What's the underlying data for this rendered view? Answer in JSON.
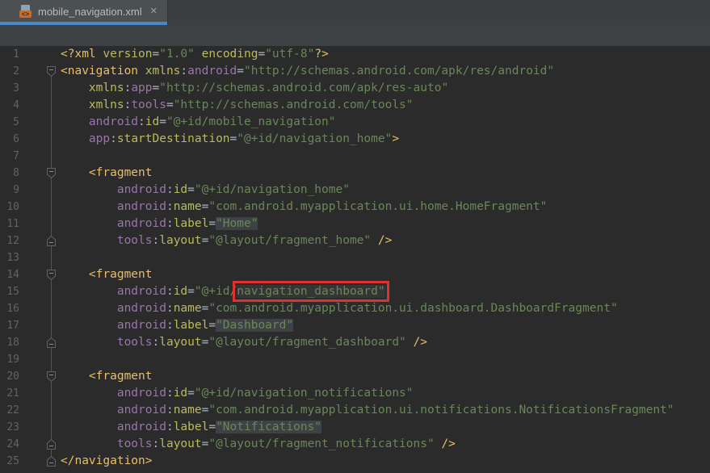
{
  "tab_bar": {
    "tabs": [
      {
        "label": "mobile_navigation.xml",
        "icon": "xml-file",
        "icon_glyph": "<>",
        "close_glyph": "✕",
        "active": true
      }
    ]
  },
  "toolbar": {},
  "colors": {
    "editor_bg": "#2B2B2B",
    "tabbar_bg": "#3C3F41",
    "active_tab_bg": "#4B5052",
    "active_tab_underline": "#4A88C7",
    "toolbar_bg": "#3E4143",
    "line_number": "#606366",
    "xml_tag": "#E8BF6A",
    "xml_attribute": "#BABB5E",
    "xml_namespace": "#9876AA",
    "xml_value": "#6A8759",
    "punctuation": "#A9B7C6",
    "label_value_highlight_bg": "#3E4245",
    "annotation_red_box": "#E03131"
  },
  "editor": {
    "annotation": {
      "shape": "red-rectangle",
      "line": 15,
      "highlighted_text": "navigation_dashboard\""
    },
    "lines": [
      {
        "num": 1,
        "fold": null,
        "tokens": [
          [
            "tag",
            "<?xml"
          ],
          [
            "sp",
            " "
          ],
          [
            "attr",
            "version"
          ],
          [
            "eq",
            "="
          ],
          [
            "val",
            "\"1.0\""
          ],
          [
            "sp",
            " "
          ],
          [
            "attr",
            "encoding"
          ],
          [
            "eq",
            "="
          ],
          [
            "val",
            "\"utf-8\""
          ],
          [
            "tag",
            "?>"
          ]
        ]
      },
      {
        "num": 2,
        "fold": "down",
        "tokens": [
          [
            "tag",
            "<navigation"
          ],
          [
            "sp",
            " "
          ],
          [
            "attr",
            "xmlns"
          ],
          [
            "eq",
            ":"
          ],
          [
            "ns",
            "android"
          ],
          [
            "eq",
            "="
          ],
          [
            "val",
            "\"http://schemas.android.com/apk/res/android\""
          ]
        ]
      },
      {
        "num": 3,
        "fold": null,
        "tokens": [
          [
            "sp",
            "    "
          ],
          [
            "attr",
            "xmlns"
          ],
          [
            "eq",
            ":"
          ],
          [
            "ns",
            "app"
          ],
          [
            "eq",
            "="
          ],
          [
            "val",
            "\"http://schemas.android.com/apk/res-auto\""
          ]
        ]
      },
      {
        "num": 4,
        "fold": null,
        "tokens": [
          [
            "sp",
            "    "
          ],
          [
            "attr",
            "xmlns"
          ],
          [
            "eq",
            ":"
          ],
          [
            "ns",
            "tools"
          ],
          [
            "eq",
            "="
          ],
          [
            "val",
            "\"http://schemas.android.com/tools\""
          ]
        ]
      },
      {
        "num": 5,
        "fold": null,
        "tokens": [
          [
            "sp",
            "    "
          ],
          [
            "ns",
            "android"
          ],
          [
            "eq",
            ":"
          ],
          [
            "attr",
            "id"
          ],
          [
            "eq",
            "="
          ],
          [
            "val",
            "\"@+id/mobile_navigation\""
          ]
        ]
      },
      {
        "num": 6,
        "fold": null,
        "tokens": [
          [
            "sp",
            "    "
          ],
          [
            "ns",
            "app"
          ],
          [
            "eq",
            ":"
          ],
          [
            "attr",
            "startDestination"
          ],
          [
            "eq",
            "="
          ],
          [
            "val",
            "\"@+id/navigation_home\""
          ],
          [
            "tag",
            ">"
          ]
        ]
      },
      {
        "num": 7,
        "fold": null,
        "tokens": []
      },
      {
        "num": 8,
        "fold": "down",
        "tokens": [
          [
            "sp",
            "    "
          ],
          [
            "tag",
            "<fragment"
          ]
        ]
      },
      {
        "num": 9,
        "fold": null,
        "tokens": [
          [
            "sp",
            "        "
          ],
          [
            "ns",
            "android"
          ],
          [
            "eq",
            ":"
          ],
          [
            "attr",
            "id"
          ],
          [
            "eq",
            "="
          ],
          [
            "val",
            "\"@+id/navigation_home\""
          ]
        ]
      },
      {
        "num": 10,
        "fold": null,
        "tokens": [
          [
            "sp",
            "        "
          ],
          [
            "ns",
            "android"
          ],
          [
            "eq",
            ":"
          ],
          [
            "attr",
            "name"
          ],
          [
            "eq",
            "="
          ],
          [
            "val",
            "\"com.android.myapplication.ui.home.HomeFragment\""
          ]
        ]
      },
      {
        "num": 11,
        "fold": null,
        "tokens": [
          [
            "sp",
            "        "
          ],
          [
            "ns",
            "android"
          ],
          [
            "eq",
            ":"
          ],
          [
            "attr",
            "label"
          ],
          [
            "eq",
            "="
          ],
          [
            "valbox",
            "\"Home\""
          ]
        ]
      },
      {
        "num": 12,
        "fold": "up",
        "tokens": [
          [
            "sp",
            "        "
          ],
          [
            "ns",
            "tools"
          ],
          [
            "eq",
            ":"
          ],
          [
            "attr",
            "layout"
          ],
          [
            "eq",
            "="
          ],
          [
            "val",
            "\"@layout/fragment_home\""
          ],
          [
            "sp",
            " "
          ],
          [
            "tag",
            "/>"
          ]
        ]
      },
      {
        "num": 13,
        "fold": null,
        "tokens": []
      },
      {
        "num": 14,
        "fold": "down",
        "tokens": [
          [
            "sp",
            "    "
          ],
          [
            "tag",
            "<fragment"
          ]
        ]
      },
      {
        "num": 15,
        "fold": null,
        "tokens": [
          [
            "sp",
            "        "
          ],
          [
            "ns",
            "android"
          ],
          [
            "eq",
            ":"
          ],
          [
            "attr",
            "id"
          ],
          [
            "eq",
            "="
          ],
          [
            "val",
            "\"@+id/"
          ],
          [
            "redbox",
            "navigation_dashboard\""
          ]
        ]
      },
      {
        "num": 16,
        "fold": null,
        "tokens": [
          [
            "sp",
            "        "
          ],
          [
            "ns",
            "android"
          ],
          [
            "eq",
            ":"
          ],
          [
            "attr",
            "name"
          ],
          [
            "eq",
            "="
          ],
          [
            "val",
            "\"com.android.myapplication.ui.dashboard.DashboardFragment\""
          ]
        ]
      },
      {
        "num": 17,
        "fold": null,
        "tokens": [
          [
            "sp",
            "        "
          ],
          [
            "ns",
            "android"
          ],
          [
            "eq",
            ":"
          ],
          [
            "attr",
            "label"
          ],
          [
            "eq",
            "="
          ],
          [
            "valbox",
            "\"Dashboard\""
          ]
        ]
      },
      {
        "num": 18,
        "fold": "up",
        "tokens": [
          [
            "sp",
            "        "
          ],
          [
            "ns",
            "tools"
          ],
          [
            "eq",
            ":"
          ],
          [
            "attr",
            "layout"
          ],
          [
            "eq",
            "="
          ],
          [
            "val",
            "\"@layout/fragment_dashboard\""
          ],
          [
            "sp",
            " "
          ],
          [
            "tag",
            "/>"
          ]
        ]
      },
      {
        "num": 19,
        "fold": null,
        "tokens": []
      },
      {
        "num": 20,
        "fold": "down",
        "tokens": [
          [
            "sp",
            "    "
          ],
          [
            "tag",
            "<fragment"
          ]
        ]
      },
      {
        "num": 21,
        "fold": null,
        "tokens": [
          [
            "sp",
            "        "
          ],
          [
            "ns",
            "android"
          ],
          [
            "eq",
            ":"
          ],
          [
            "attr",
            "id"
          ],
          [
            "eq",
            "="
          ],
          [
            "val",
            "\"@+id/navigation_notifications\""
          ]
        ]
      },
      {
        "num": 22,
        "fold": null,
        "tokens": [
          [
            "sp",
            "        "
          ],
          [
            "ns",
            "android"
          ],
          [
            "eq",
            ":"
          ],
          [
            "attr",
            "name"
          ],
          [
            "eq",
            "="
          ],
          [
            "val",
            "\"com.android.myapplication.ui.notifications.NotificationsFragment\""
          ]
        ]
      },
      {
        "num": 23,
        "fold": null,
        "tokens": [
          [
            "sp",
            "        "
          ],
          [
            "ns",
            "android"
          ],
          [
            "eq",
            ":"
          ],
          [
            "attr",
            "label"
          ],
          [
            "eq",
            "="
          ],
          [
            "valbox",
            "\"Notifications\""
          ]
        ]
      },
      {
        "num": 24,
        "fold": "up",
        "tokens": [
          [
            "sp",
            "        "
          ],
          [
            "ns",
            "tools"
          ],
          [
            "eq",
            ":"
          ],
          [
            "attr",
            "layout"
          ],
          [
            "eq",
            "="
          ],
          [
            "val",
            "\"@layout/fragment_notifications\""
          ],
          [
            "sp",
            " "
          ],
          [
            "tag",
            "/>"
          ]
        ]
      },
      {
        "num": 25,
        "fold": "up",
        "tokens": [
          [
            "tag",
            "</navigation>"
          ]
        ]
      }
    ]
  }
}
